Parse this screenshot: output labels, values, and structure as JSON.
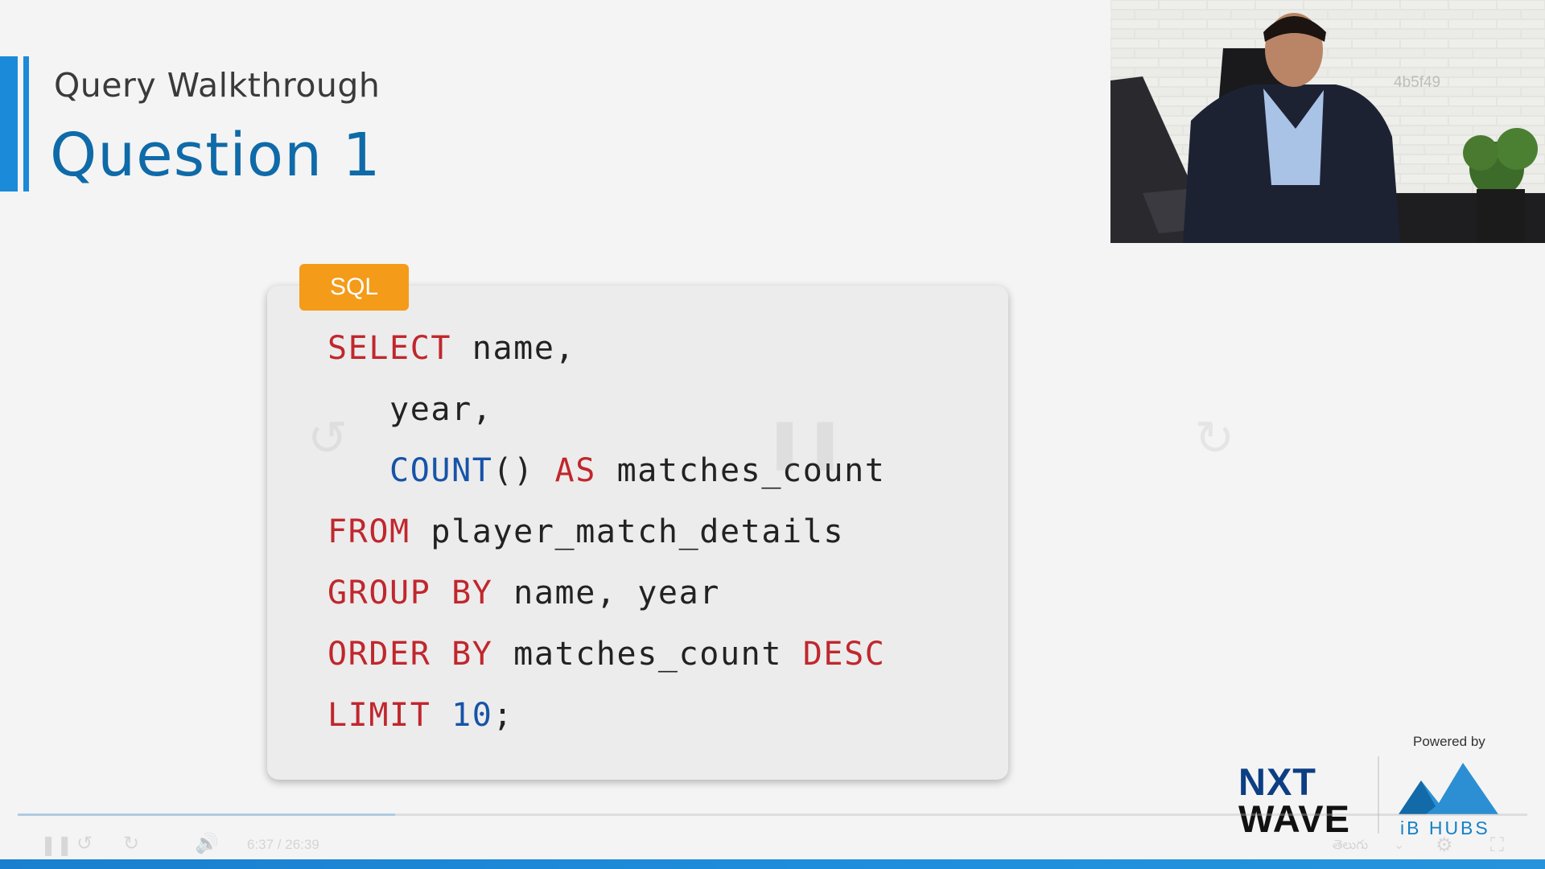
{
  "slide": {
    "subtitle": "Query Walkthrough",
    "title": "Question 1"
  },
  "code": {
    "language": "SQL",
    "lines": [
      [
        {
          "t": "kw",
          "v": "SELECT"
        },
        {
          "t": "plain",
          "v": " name,"
        }
      ],
      [
        {
          "t": "plain",
          "v": "   year,"
        }
      ],
      [
        {
          "t": "plain",
          "v": "   "
        },
        {
          "t": "fn",
          "v": "COUNT"
        },
        {
          "t": "plain",
          "v": "() "
        },
        {
          "t": "kw",
          "v": "AS"
        },
        {
          "t": "plain",
          "v": " matches_count"
        }
      ],
      [
        {
          "t": "kw",
          "v": "FROM"
        },
        {
          "t": "plain",
          "v": " player_match_details"
        }
      ],
      [
        {
          "t": "kw",
          "v": "GROUP BY"
        },
        {
          "t": "plain",
          "v": " name, year"
        }
      ],
      [
        {
          "t": "kw",
          "v": "ORDER BY"
        },
        {
          "t": "plain",
          "v": " matches_count "
        },
        {
          "t": "kw",
          "v": "DESC"
        }
      ],
      [
        {
          "t": "kw",
          "v": "LIMIT"
        },
        {
          "t": "plain",
          "v": " "
        },
        {
          "t": "num",
          "v": "10"
        },
        {
          "t": "plain",
          "v": ";"
        }
      ]
    ]
  },
  "webcam": {
    "watermark": "4b5f49"
  },
  "branding": {
    "powered_by": "Powered by",
    "nxt": "NXT",
    "wave": "WAVE",
    "ibhubs": "iB HUBS"
  },
  "player": {
    "time": "6:37 / 26:39",
    "language": "తెలుగు",
    "progress": 0.25
  },
  "colors": {
    "accent": "#1b8ad8",
    "title": "#0f6aa8",
    "keyword": "#c0272d",
    "function": "#1753a8",
    "badge": "#f49b1a"
  }
}
